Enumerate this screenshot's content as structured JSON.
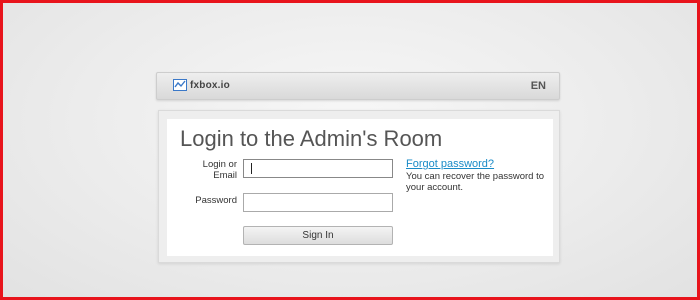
{
  "header": {
    "logo_text": "fxbox.io",
    "language": "EN"
  },
  "login": {
    "title": "Login to the Admin's Room",
    "login_label": "Login or Email",
    "login_value": "",
    "password_label": "Password",
    "password_value": "",
    "forgot_link": "Forgot password?",
    "recover_text": "You can recover the password to your account.",
    "signin_button": "Sign In"
  },
  "colors": {
    "border_accent": "#e8141c",
    "link": "#1a8bc7",
    "logo_icon": "#3a78c8"
  },
  "icons": {
    "logo": "chart-line-icon"
  }
}
